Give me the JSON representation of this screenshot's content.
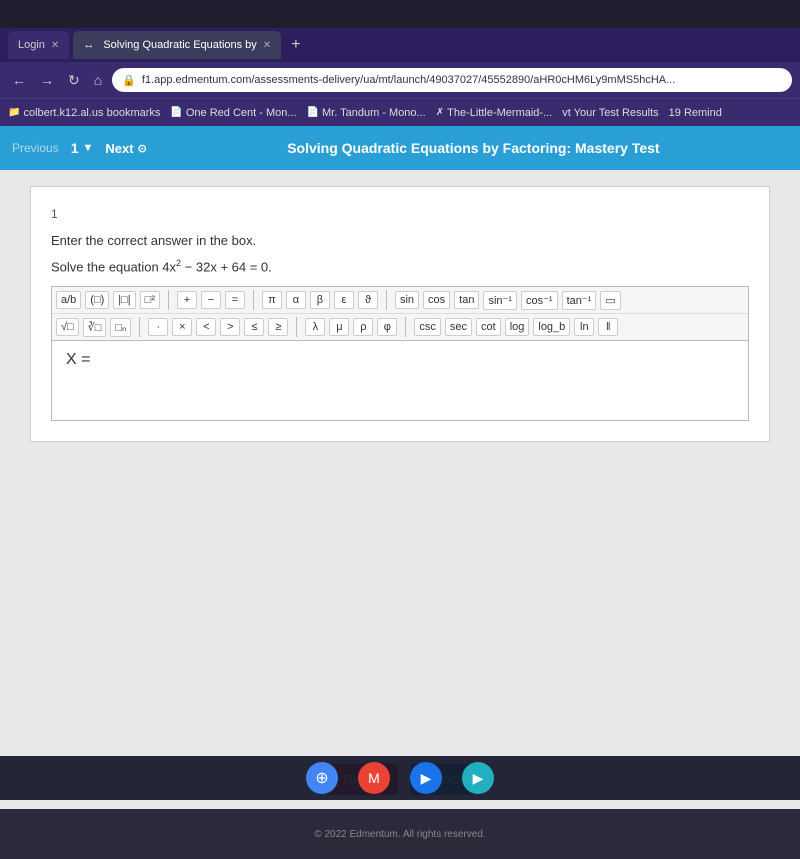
{
  "topBar": {},
  "tabs": {
    "tab1": {
      "label": "Login",
      "active": false
    },
    "tab2": {
      "label": "Solving Quadratic Equations by",
      "active": true
    },
    "addTab": "+"
  },
  "addressBar": {
    "url": "f1.app.edmentum.com/assessments-delivery/ua/mt/launch/49037027/45552890/aHR0cHM6Ly9mMS5hcHA..."
  },
  "bookmarks": [
    {
      "label": "colbert.k12.al.us bookmarks"
    },
    {
      "label": "One Red Cent - Mon..."
    },
    {
      "label": "Mr. Tandum - Mono..."
    },
    {
      "label": "The-Little-Mermaid-..."
    },
    {
      "label": "vt  Your Test Results"
    },
    {
      "label": "19  Remind"
    }
  ],
  "edToolbar": {
    "previous": "Previous",
    "questionNumber": "1",
    "next": "Next",
    "title": "Solving Quadratic Equations by Factoring: Mastery Test"
  },
  "question": {
    "number": "1",
    "instruction": "Enter the correct answer in the box.",
    "text": "Solve the equation 4x² − 32x + 64 = 0.",
    "inputLabel": "X =",
    "mathToolbarButtons": {
      "row1": [
        "a/b",
        "(□)",
        "|□|",
        "□²",
        "+",
        "−",
        "=",
        "π",
        "α",
        "β",
        "ε",
        "ϑ",
        "sin",
        "cos",
        "tan",
        "sin⁻¹",
        "cos⁻¹",
        "tan⁻¹"
      ],
      "row2": [
        "√□",
        "∛□",
        "□ₙ",
        "·",
        "×",
        "<",
        ">",
        "≤",
        "≥",
        "λ",
        "μ",
        "ρ",
        "φ",
        "csc",
        "sec",
        "cot",
        "log",
        "log_b",
        "ln",
        "‖"
      ]
    }
  },
  "buttons": {
    "reset": "Reset",
    "next": "Next"
  },
  "footer": {
    "copyright": "© 2022 Edmentum. All rights reserved."
  }
}
